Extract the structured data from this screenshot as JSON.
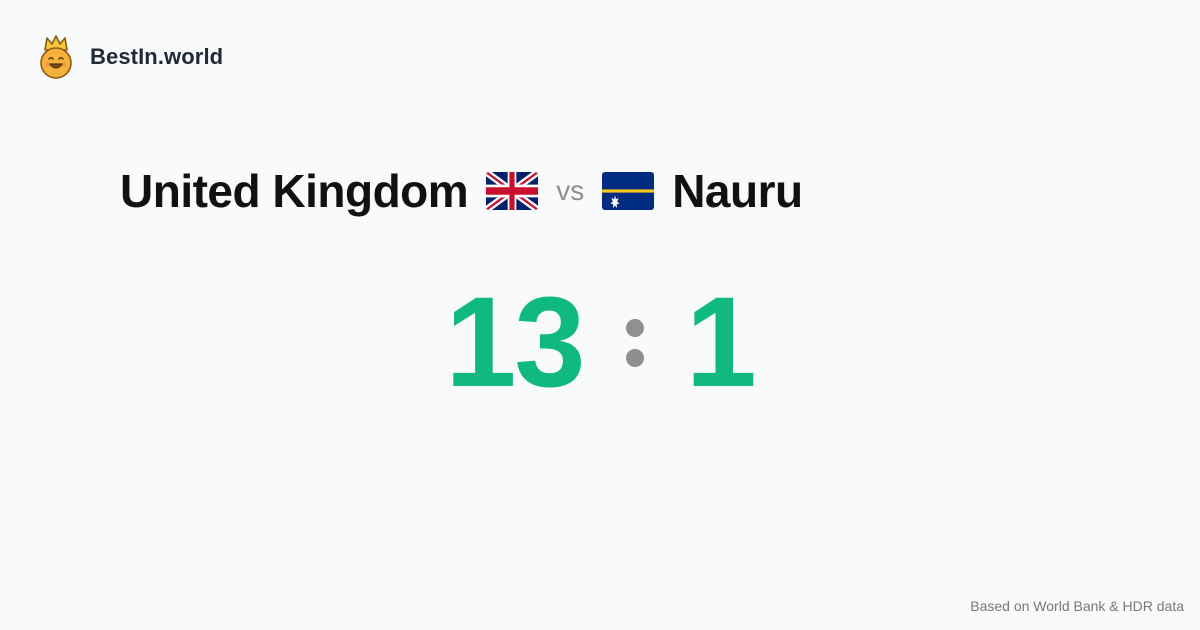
{
  "brand": {
    "name": "BestIn.world",
    "logo_icon": "crowned-smiley-logo-icon"
  },
  "comparison": {
    "left_country": "United Kingdom",
    "left_flag_icon": "uk-flag-icon",
    "vs_label": "vs",
    "right_country": "Nauru",
    "right_flag_icon": "nauru-flag-icon",
    "left_score": "13",
    "right_score": "1",
    "score_color": "#10b981"
  },
  "footer": {
    "note": "Based on World Bank & HDR data"
  }
}
